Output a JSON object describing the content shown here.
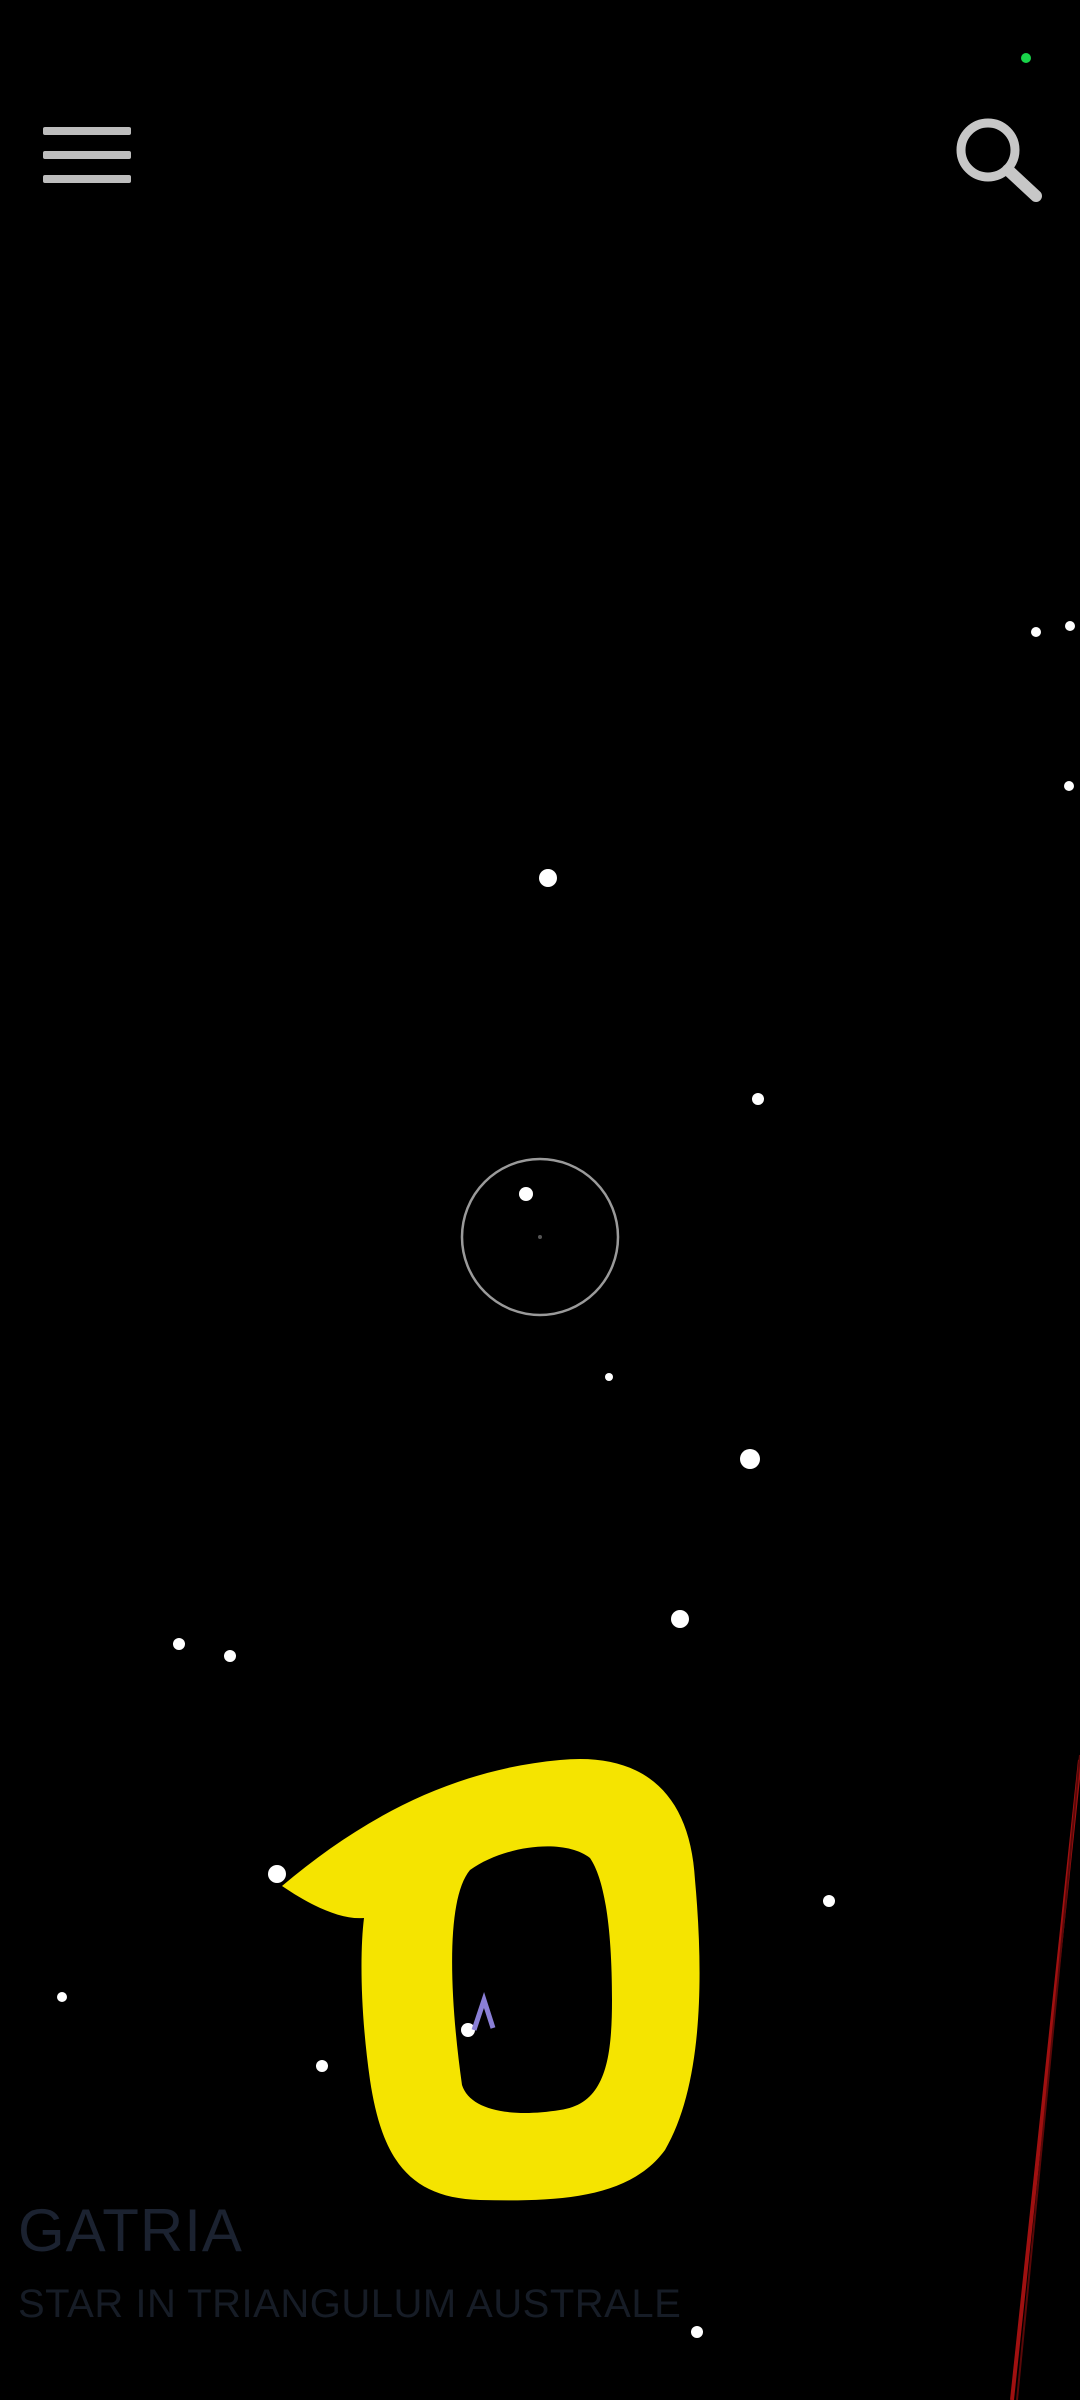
{
  "toolbar": {
    "menu_icon": "hamburger-menu-icon",
    "search_icon": "search-icon"
  },
  "status": {
    "indicator_color": "#19d44a"
  },
  "selected_object": {
    "name": "GATRIA",
    "description": "STAR IN TRIANGULUM AUSTRALE"
  },
  "overlay": {
    "annotation_color": "#f5e400",
    "annotation_icon": "handwritten-zero-mark"
  },
  "sky": {
    "horizon_line_color": "#a01010",
    "reticle_color": "#9a9a9a"
  }
}
